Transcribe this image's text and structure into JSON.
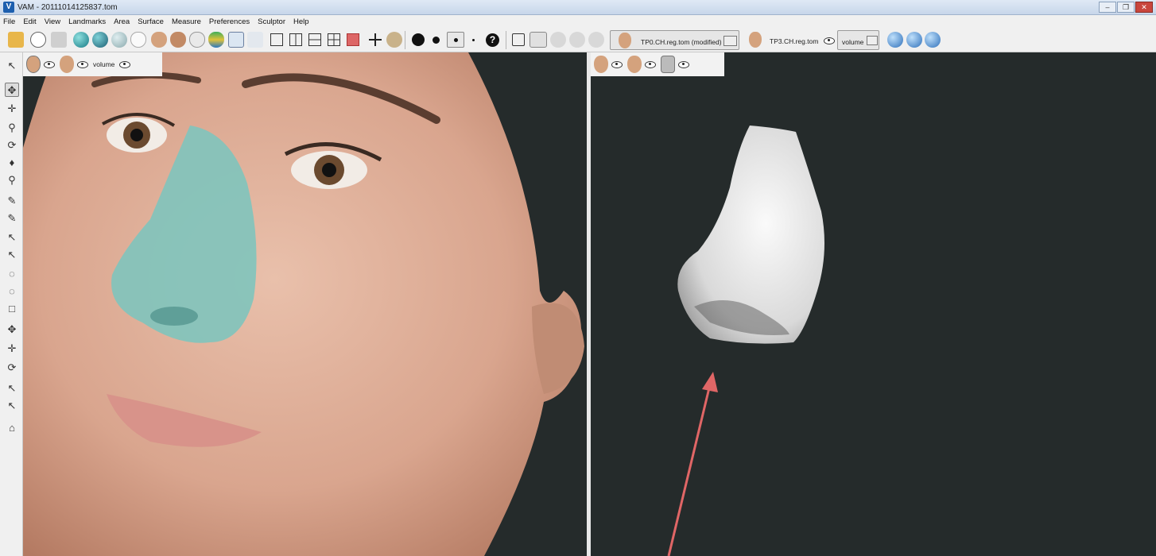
{
  "window": {
    "title": "VAM - 20111014125837.tom",
    "logo": "V"
  },
  "menu": [
    "File",
    "Edit",
    "View",
    "Landmarks",
    "Area",
    "Surface",
    "Measure",
    "Preferences",
    "Sculptor",
    "Help"
  ],
  "toolbar": {
    "model_slots": [
      {
        "label": "TP0.CH.reg.tom (modified)"
      },
      {
        "label": "TP3.CH.reg.tom"
      },
      {
        "label": "volume"
      }
    ]
  },
  "left_view": {
    "volume_label": "volume"
  },
  "colors": {
    "viewport_bg": "#252b2b",
    "nose_overlay": "#7fc4bc",
    "arrow": "#e06666"
  }
}
